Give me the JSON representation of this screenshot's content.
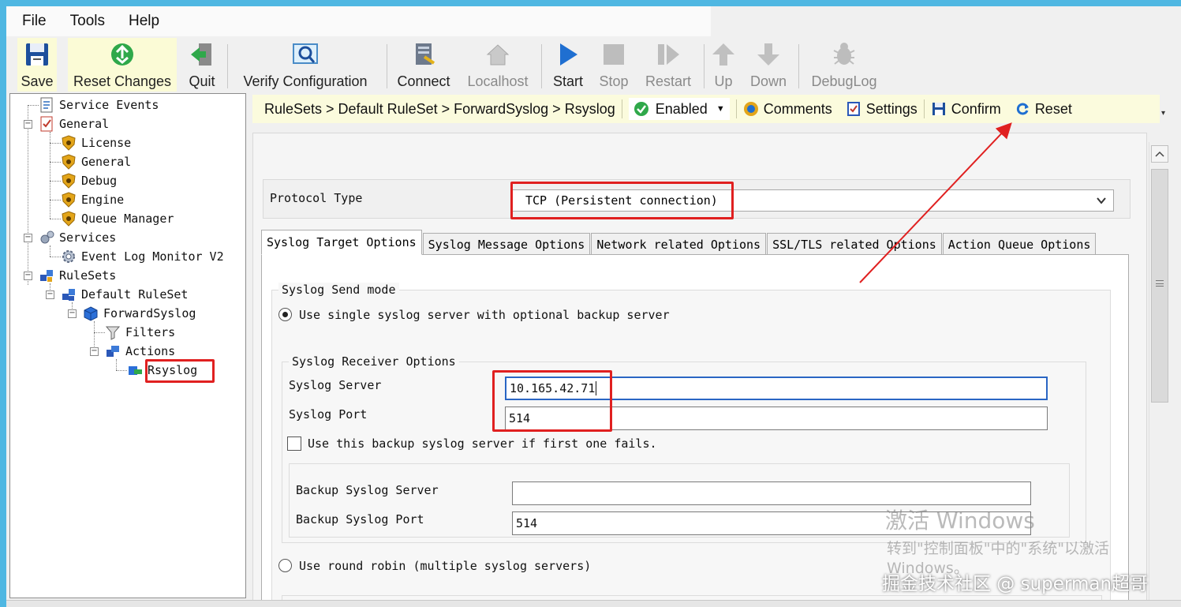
{
  "menu": {
    "items": [
      "File",
      "Tools",
      "Help"
    ]
  },
  "toolbar": {
    "save": "Save",
    "reset_changes": "Reset Changes",
    "quit": "Quit",
    "verify_configuration": "Verify Configuration",
    "connect": "Connect",
    "localhost": "Localhost",
    "start": "Start",
    "stop": "Stop",
    "restart": "Restart",
    "up": "Up",
    "down": "Down",
    "debuglog": "DebugLog"
  },
  "tree": {
    "service_events": "Service Events",
    "general": "General",
    "license": "License",
    "general_child": "General",
    "debug": "Debug",
    "engine": "Engine",
    "queue_manager": "Queue Manager",
    "services": "Services",
    "event_log_monitor": "Event Log Monitor V2",
    "rulesets": "RuleSets",
    "default_ruleset": "Default RuleSet",
    "forward_syslog": "ForwardSyslog",
    "filters": "Filters",
    "actions": "Actions",
    "rsyslog": "Rsyslog"
  },
  "breadcrumb": {
    "path": "RuleSets > Default RuleSet > ForwardSyslog > Rsyslog",
    "status": "Enabled",
    "comments": "Comments",
    "settings": "Settings",
    "confirm": "Confirm",
    "reset": "Reset"
  },
  "form": {
    "protocol_type_label": "Protocol Type",
    "protocol_type_value": "TCP (Persistent connection)",
    "tabs": [
      "Syslog Target Options",
      "Syslog Message Options",
      "Network related Options",
      "SSL/TLS related Options",
      "Action Queue Options"
    ],
    "send_mode_title": "Syslog Send mode",
    "single_server_label": "Use single syslog server with optional backup server",
    "receiver_options_title": "Syslog Receiver Options",
    "syslog_server_label": "Syslog Server",
    "syslog_server_value": "10.165.42.71",
    "syslog_port_label": "Syslog Port",
    "syslog_port_value": "514",
    "backup_checkbox_label": "Use this backup syslog server if first one fails.",
    "backup_server_label": "Backup Syslog Server",
    "backup_server_value": "",
    "backup_port_label": "Backup Syslog Port",
    "backup_port_value": "514",
    "round_robin_label": "Use round robin (multiple syslog servers)"
  },
  "overlay": {
    "watermark_line1": "激活 Windows",
    "watermark_line2": "转到\"控制面板\"中的\"系统\"以激活",
    "watermark_line3": "Windows。",
    "credit": "掘金技术社区 @ superman超哥"
  },
  "colors": {
    "window_border": "#4fb7e2",
    "highlight_bar": "#fbfbdd",
    "annotation_red": "#e02020"
  }
}
